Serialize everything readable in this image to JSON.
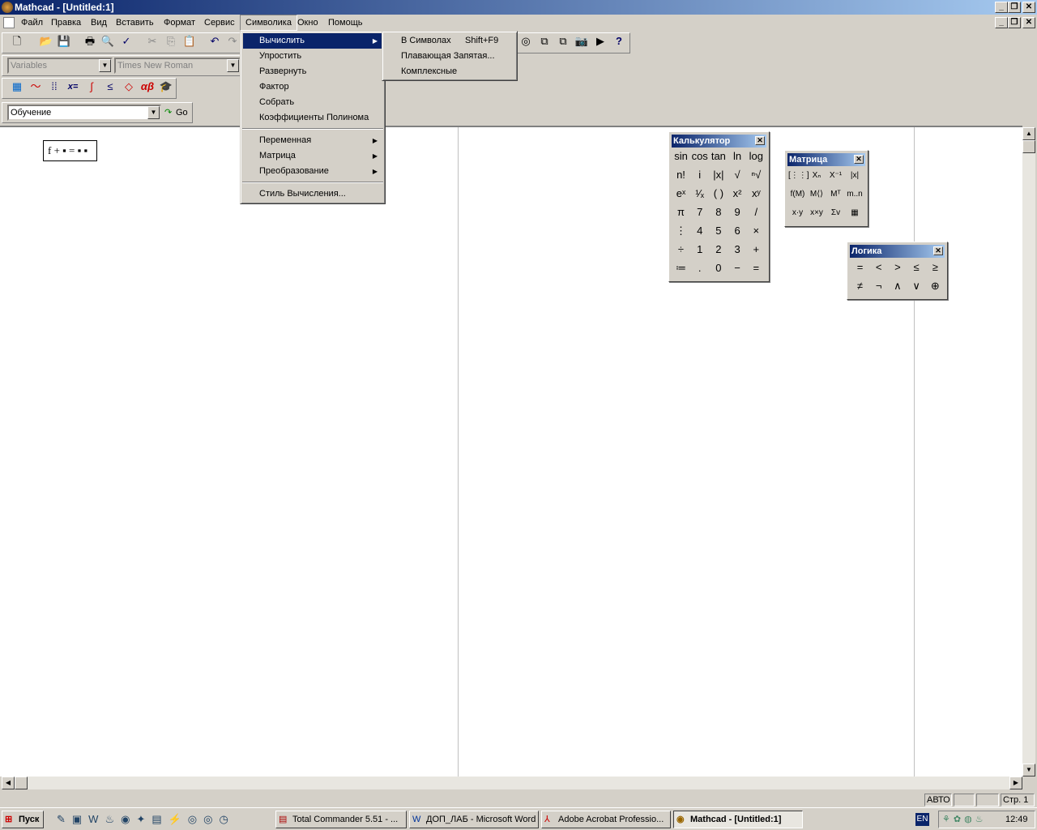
{
  "window": {
    "title": "Mathcad - [Untitled:1]"
  },
  "menubar": [
    "Файл",
    "Правка",
    "Вид",
    "Вставить",
    "Формат",
    "Сервис",
    "Символика",
    "Окно",
    "Помощь"
  ],
  "toolbar": {
    "style_combo": "Variables",
    "font_combo": "Times New Roman",
    "resource_combo": "Обучение",
    "go_label": "Go"
  },
  "symbolics_menu": {
    "items": [
      "Вычислить",
      "Упростить",
      "Развернуть",
      "Фактор",
      "Собрать",
      "Коэффициенты Полинома",
      "Переменная",
      "Матрица",
      "Преобразование",
      "Стиль Вычисления..."
    ]
  },
  "evaluate_submenu": {
    "items": [
      {
        "label": "В Символах",
        "shortcut": "Shift+F9"
      },
      {
        "label": "Плавающая Запятая...",
        "shortcut": ""
      },
      {
        "label": "Комплексные",
        "shortcut": ""
      }
    ]
  },
  "worksheet": {
    "expression": "f + ▪ = ▪ ▪"
  },
  "calculator": {
    "title": "Калькулятор",
    "buttons": [
      "sin",
      "cos",
      "tan",
      "ln",
      "log",
      "n!",
      "i",
      "|x|",
      "√",
      "ⁿ√",
      "eˣ",
      "¹⁄ₓ",
      "( )",
      "x²",
      "xʸ",
      "π",
      "7",
      "8",
      "9",
      "/",
      "⋮",
      "4",
      "5",
      "6",
      "×",
      "÷",
      "1",
      "2",
      "3",
      "+",
      "≔",
      ".",
      "0",
      "−",
      "="
    ]
  },
  "matrix": {
    "title": "Матрица",
    "buttons": [
      "[⋮⋮]",
      "Xₙ",
      "X⁻¹",
      "|x|",
      "f(M)",
      "M⟨⟩",
      "Mᵀ",
      "m..n",
      "x·y",
      "x×y",
      "Σv",
      "▦"
    ]
  },
  "logic": {
    "title": "Логика",
    "buttons": [
      "=",
      "<",
      ">",
      "≤",
      "≥",
      "≠",
      "¬",
      "∧",
      "∨",
      "⊕"
    ]
  },
  "status": {
    "mode": "АВТО",
    "page": "Стр. 1"
  },
  "taskbar": {
    "start": "Пуск",
    "tasks": [
      "Total Commander 5.51 - ...",
      "ДОП_ЛАБ - Microsoft Word",
      "Adobe Acrobat Professio...",
      "Mathcad - [Untitled:1]"
    ],
    "lang": "EN",
    "clock": "12:49"
  }
}
